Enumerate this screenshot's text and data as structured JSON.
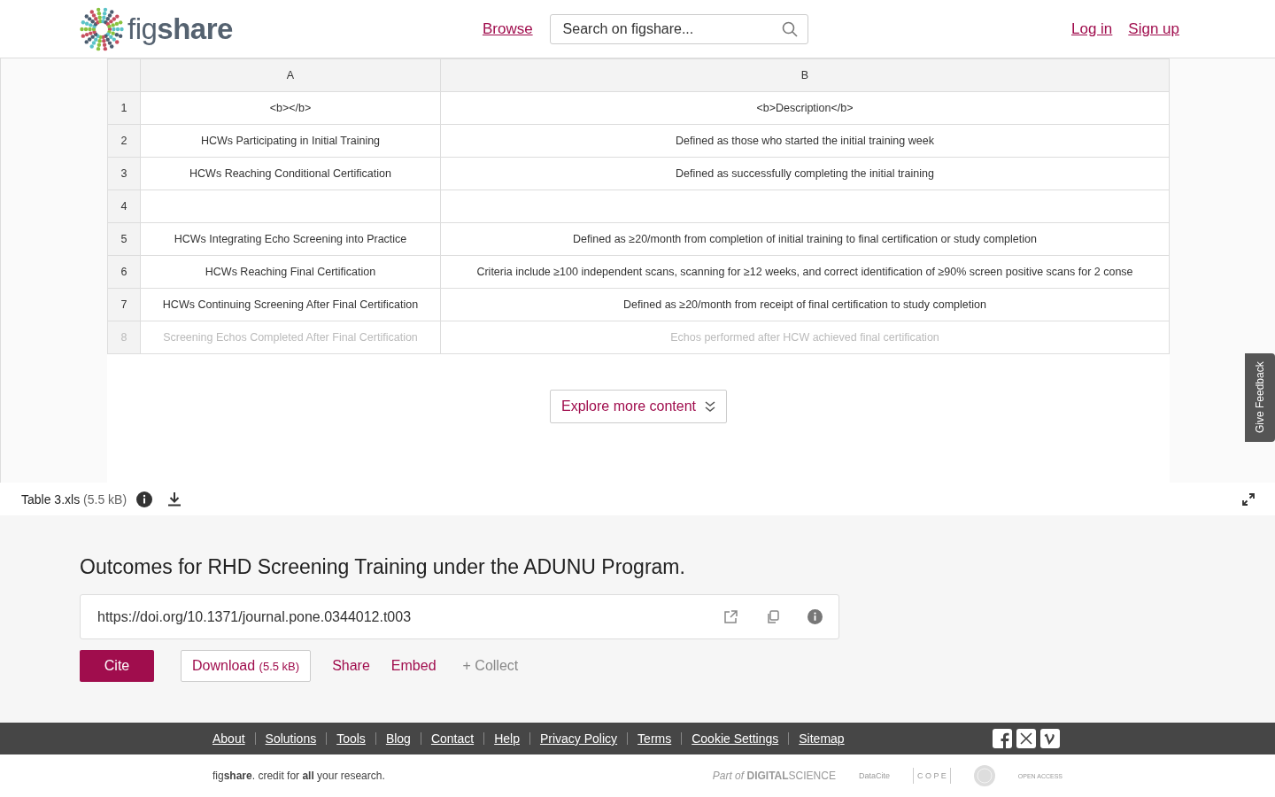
{
  "header": {
    "logo": "fig**share**",
    "nav": [
      {
        "label": "Browse"
      }
    ],
    "search": {
      "placeholder": "Search on figshare..."
    },
    "account": [
      {
        "label": "Log in"
      },
      {
        "label": "Sign up"
      }
    ]
  },
  "table": {
    "columns": [
      "A",
      "B"
    ],
    "rows": [
      {
        "num": "1",
        "cells": [
          "<b></b>",
          "<b>Description</b>"
        ],
        "faded": false
      },
      {
        "num": "2",
        "cells": [
          "HCWs Participating in Initial Training",
          "Defined as those who started the initial training week"
        ],
        "faded": false
      },
      {
        "num": "3",
        "cells": [
          "HCWs Reaching Conditional Certification",
          "Defined as successfully completing the initial training"
        ],
        "faded": false
      },
      {
        "num": "4",
        "cells": [
          "",
          ""
        ],
        "faded": false
      },
      {
        "num": "5",
        "cells": [
          "HCWs Integrating Echo Screening into Practice",
          "Defined as ≥20/month from completion of initial training to final certification or study completion"
        ],
        "faded": false
      },
      {
        "num": "6",
        "cells": [
          "HCWs Reaching Final Certification",
          "Criteria include ≥100 independent scans, scanning for ≥12 weeks, and correct identification of ≥90% screen positive scans for 2 conse"
        ],
        "faded": false
      },
      {
        "num": "7",
        "cells": [
          "HCWs Continuing Screening After Final Certification",
          "Defined as ≥20/month from receipt of final certification to study completion"
        ],
        "faded": false
      },
      {
        "num": "8",
        "cells": [
          "Screening Echos Completed After Final Certification",
          "Echos performed after HCW achieved final certification"
        ],
        "faded": true
      }
    ]
  },
  "explore_button": "Explore more content",
  "feedback_tab": "Give Feedback",
  "file_bar": {
    "name": "Table 3.xls",
    "size": "(5.5 kB)"
  },
  "item": {
    "title": "Outcomes for RHD Screening Training under the ADUNU Program.",
    "doi": "https://doi.org/10.1371/journal.pone.0344012.t003",
    "actions": [
      {
        "kind": "primary",
        "label": "Cite"
      },
      {
        "kind": "outline",
        "label": "Download",
        "extra": "(5.5 kB)"
      },
      {
        "kind": "link",
        "label": "Share"
      },
      {
        "kind": "link",
        "label": "Embed"
      },
      {
        "kind": "muted",
        "label": "+ Collect"
      }
    ]
  },
  "footer": {
    "links": [
      "About",
      "Solutions",
      "Tools",
      "Blog",
      "Contact",
      "Help",
      "Privacy Policy",
      "Terms",
      "Cookie Settings",
      "Sitemap"
    ],
    "tagline": "fig**share**. credit for **all** your research.",
    "partners": [
      {
        "kind": "digital",
        "text": "*Part of* **DIGITAL**SCIENCE"
      },
      {
        "kind": "datacite",
        "text": "DataCite"
      },
      {
        "kind": "cope",
        "text": "C O P E"
      },
      {
        "kind": "seal"
      },
      {
        "kind": "oa",
        "text": "OPEN ACCESS"
      }
    ]
  }
}
